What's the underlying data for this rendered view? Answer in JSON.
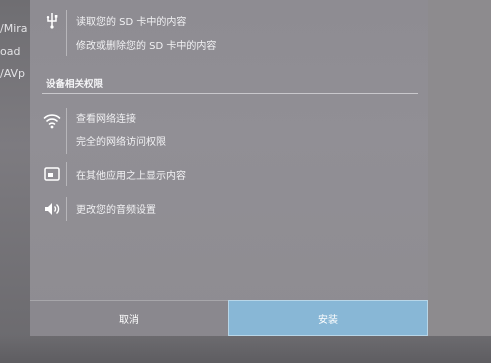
{
  "background": {
    "left_fragments": [
      "/Mira",
      "oad",
      "/AVp"
    ]
  },
  "dialog": {
    "permissions_top": [
      "读取您的 SD 卡中的内容",
      "修改或删除您的 SD 卡中的内容"
    ],
    "section_title": "设备相关权限",
    "device_permissions": {
      "network_view": "查看网络连接",
      "network_full": "完全的网络访问权限",
      "overlay": "在其他应用之上显示内容",
      "audio": "更改您的音频设置"
    },
    "buttons": {
      "cancel": "取消",
      "install": "安装"
    },
    "colors": {
      "dialog_bg": "#8f8d93",
      "install_button": "#88b7d6",
      "text": "#f2f2f4"
    }
  }
}
